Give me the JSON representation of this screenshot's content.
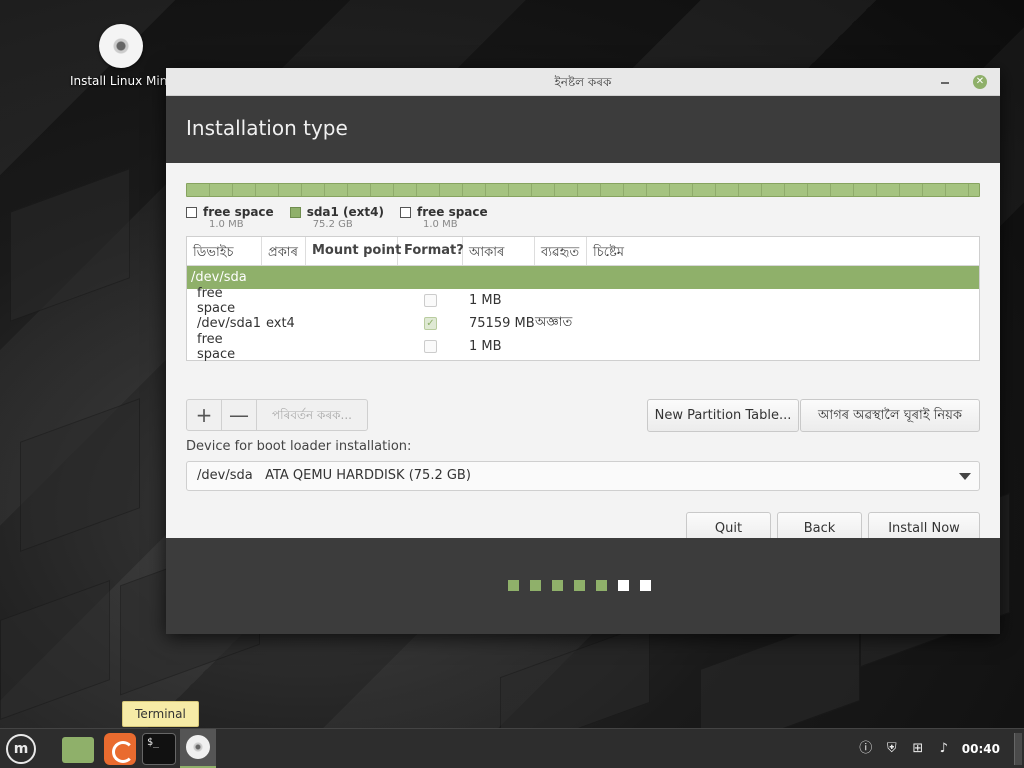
{
  "desktop": {
    "icon_label": "Install Linux Mint"
  },
  "window": {
    "title": "ইনষ্টল কৰক",
    "close_glyph": "✕",
    "header_title": "Installation type"
  },
  "legend": [
    {
      "name": "free space",
      "size": "1.0 MB",
      "color": "#ffffff"
    },
    {
      "name": "sda1 (ext4)",
      "size": "75.2 GB",
      "color": "#8fb06a"
    },
    {
      "name": "free space",
      "size": "1.0 MB",
      "color": "#ffffff"
    }
  ],
  "table": {
    "headers": [
      "ডিভাইচ",
      "প্ৰকাৰ",
      "Mount point",
      "Format?",
      "আকাৰ",
      "ব্যৱহৃত",
      "চিষ্টেম"
    ],
    "rows": [
      {
        "device": "/dev/sda",
        "type": "",
        "mount": "",
        "format": false,
        "size": "",
        "used": "",
        "selected": true
      },
      {
        "device": "free space",
        "type": "",
        "mount": "",
        "format": false,
        "size": "1 MB",
        "used": ""
      },
      {
        "device": "/dev/sda1",
        "type": "ext4",
        "mount": "",
        "format": true,
        "size": "75159 MB",
        "used": "অজ্ঞাত"
      },
      {
        "device": "free space",
        "type": "",
        "mount": "",
        "format": false,
        "size": "1 MB",
        "used": ""
      }
    ]
  },
  "tools": {
    "add": "+",
    "remove": "—",
    "change": "পৰিবৰ্তন কৰক..."
  },
  "buttons": {
    "new_partition_table": "New Partition Table...",
    "revert": "আগৰ অৱস্থালৈ ঘূৰাই নিয়ক",
    "quit": "Quit",
    "back": "Back",
    "install_now": "Install Now"
  },
  "boot": {
    "label": "Device for boot loader installation:",
    "value": "/dev/sda   ATA QEMU HARDDISK (75.2 GB)"
  },
  "progress": {
    "total_steps": 7,
    "completed_steps": 5,
    "accent": "#8fb06a"
  },
  "tooltip": "Terminal",
  "taskbar": {
    "terminal_prompt": "$_",
    "clock": "00:40",
    "apps": [
      "menu-icon",
      "files-icon",
      "firefox-icon",
      "terminal-icon",
      "installer-icon"
    ],
    "tray": [
      "update-icon",
      "shield-icon",
      "network-icon",
      "volume-icon"
    ]
  }
}
